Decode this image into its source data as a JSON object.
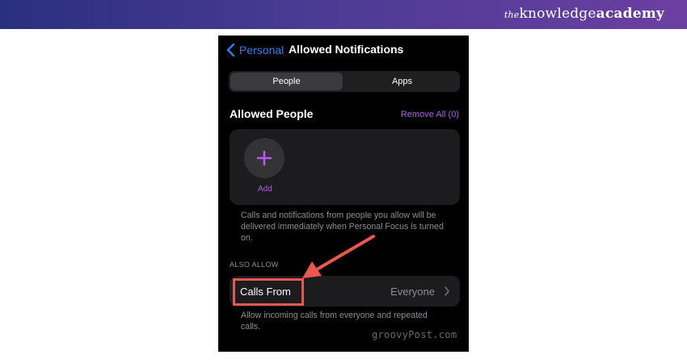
{
  "brand": {
    "prefix": "the",
    "name_regular": "knowledge",
    "name_bold": "academy"
  },
  "nav": {
    "back_label": "Personal",
    "title": "Allowed Notifications"
  },
  "segments": [
    {
      "label": "People",
      "selected": true
    },
    {
      "label": "Apps",
      "selected": false
    }
  ],
  "allowed_people": {
    "heading": "Allowed People",
    "remove_all": "Remove All (0)",
    "add_label": "Add",
    "footnote": "Calls and notifications from people you allow will be delivered immediately when Personal Focus is turned on."
  },
  "also_allow": {
    "heading": "ALSO ALLOW",
    "calls_from_label": "Calls From",
    "calls_from_value": "Everyone",
    "footnote": "Allow incoming calls from everyone and repeated calls."
  },
  "watermark": "groovyPost.com",
  "colors": {
    "accent_purple": "#b45bf0",
    "link_blue": "#2f7cf6",
    "highlight_red": "#e9574f",
    "banner_start": "#2a2f7e",
    "banner_end": "#6b3fa2"
  }
}
